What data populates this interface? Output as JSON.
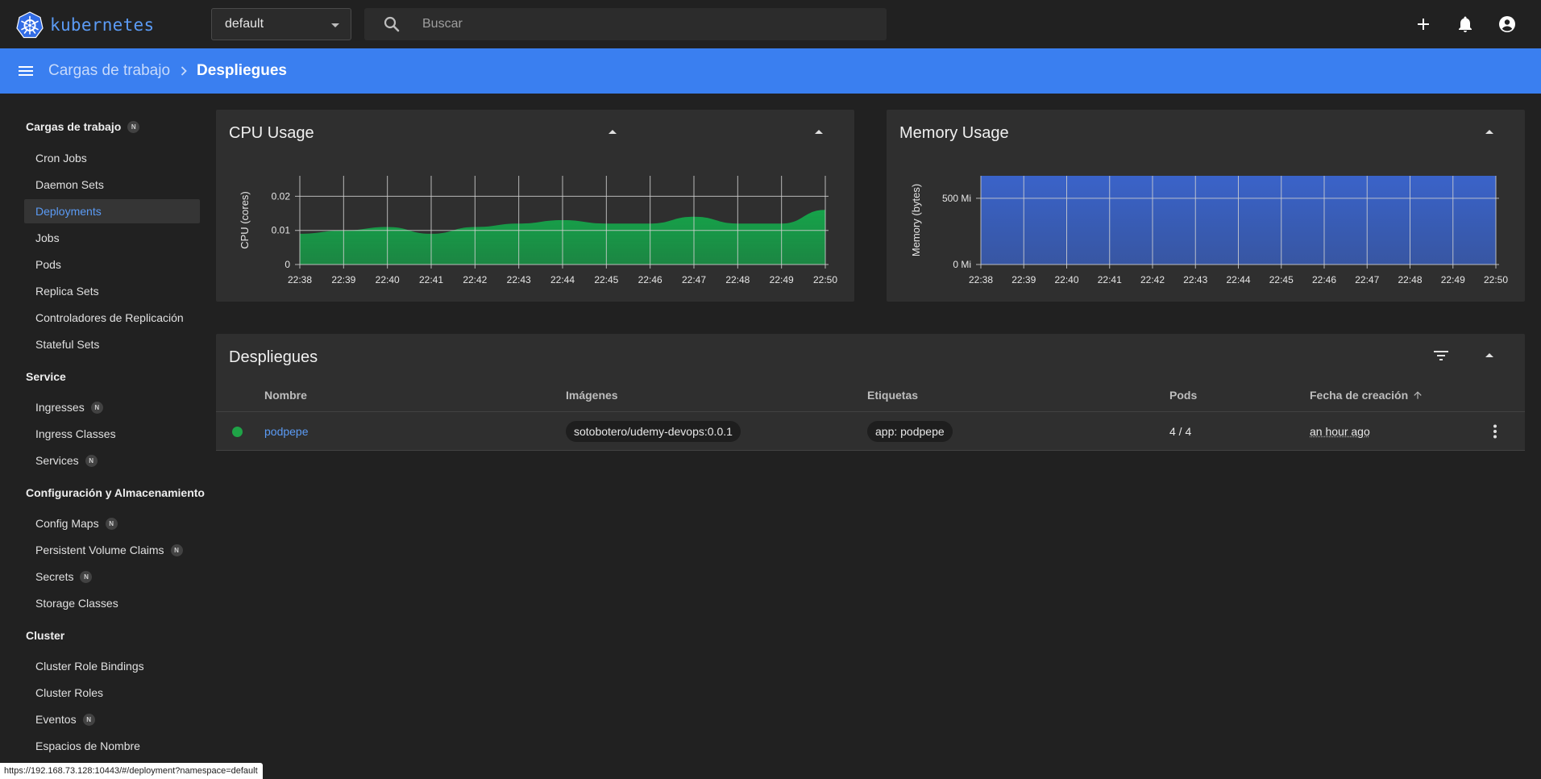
{
  "topbar": {
    "logo_text": "kubernetes",
    "namespace": "default",
    "search_placeholder": "Buscar"
  },
  "breadcrumb": {
    "parent": "Cargas de trabajo",
    "current": "Despliegues"
  },
  "sidebar": {
    "workloads_header": "Cargas de trabajo",
    "workloads_badge": "N",
    "workloads": [
      "Cron Jobs",
      "Daemon Sets",
      "Deployments",
      "Jobs",
      "Pods",
      "Replica Sets",
      "Controladores de Replicación",
      "Stateful Sets"
    ],
    "active_item": "Deployments",
    "service_header": "Service",
    "service": [
      "Ingresses",
      "Ingress Classes",
      "Services"
    ],
    "config_header": "Configuración y Almacenamiento",
    "config": [
      "Config Maps",
      "Persistent Volume Claims",
      "Secrets",
      "Storage Classes"
    ],
    "cluster_header": "Cluster",
    "cluster": [
      "Cluster Role Bindings",
      "Cluster Roles",
      "Eventos",
      "Espacios de Nombre"
    ],
    "badge": "N"
  },
  "cpu_card": {
    "title": "CPU Usage"
  },
  "memory_card": {
    "title": "Memory Usage"
  },
  "chart_data": [
    {
      "type": "area",
      "title": "CPU Usage",
      "xlabel": "",
      "ylabel": "CPU (cores)",
      "x": [
        "22:38",
        "22:39",
        "22:40",
        "22:41",
        "22:42",
        "22:43",
        "22:44",
        "22:45",
        "22:46",
        "22:47",
        "22:48",
        "22:49",
        "22:50"
      ],
      "values": [
        0.009,
        0.01,
        0.011,
        0.009,
        0.011,
        0.012,
        0.013,
        0.012,
        0.012,
        0.014,
        0.012,
        0.012,
        0.016
      ],
      "yticks": [
        "0",
        "0.01",
        "0.02"
      ],
      "ytick_values": [
        0,
        0.01,
        0.02
      ],
      "ylim": [
        0,
        0.026
      ],
      "grid": true,
      "color": "#16a34a"
    },
    {
      "type": "area",
      "title": "Memory Usage",
      "xlabel": "",
      "ylabel": "Memory (bytes)",
      "x": [
        "22:38",
        "22:39",
        "22:40",
        "22:41",
        "22:42",
        "22:43",
        "22:44",
        "22:45",
        "22:46",
        "22:47",
        "22:48",
        "22:49",
        "22:50"
      ],
      "values": [
        670,
        670,
        670,
        670,
        670,
        670,
        670,
        670,
        670,
        670,
        670,
        670,
        670
      ],
      "unit": "Mi",
      "yticks": [
        "0 Mi",
        "500 Mi"
      ],
      "ytick_values": [
        0,
        500
      ],
      "ylim": [
        0,
        670
      ],
      "grid": true,
      "color": "#3a63c9"
    }
  ],
  "deployments": {
    "title": "Despliegues",
    "columns": {
      "name": "Nombre",
      "images": "Imágenes",
      "labels": "Etiquetas",
      "pods": "Pods",
      "created": "Fecha de creación"
    },
    "rows": [
      {
        "name": "podpepe",
        "image": "sotobotero/udemy-devops:0.0.1",
        "label": "app: podpepe",
        "pods": "4 / 4",
        "created": "an hour ago",
        "status_color": "#1fa347"
      }
    ]
  },
  "status_url": "https://192.168.73.128:10443/#/deployment?namespace=default",
  "colors": {
    "accent": "#3a7ff0",
    "link": "#5b9bf5",
    "background": "#212121",
    "card": "#2f2f2f"
  }
}
